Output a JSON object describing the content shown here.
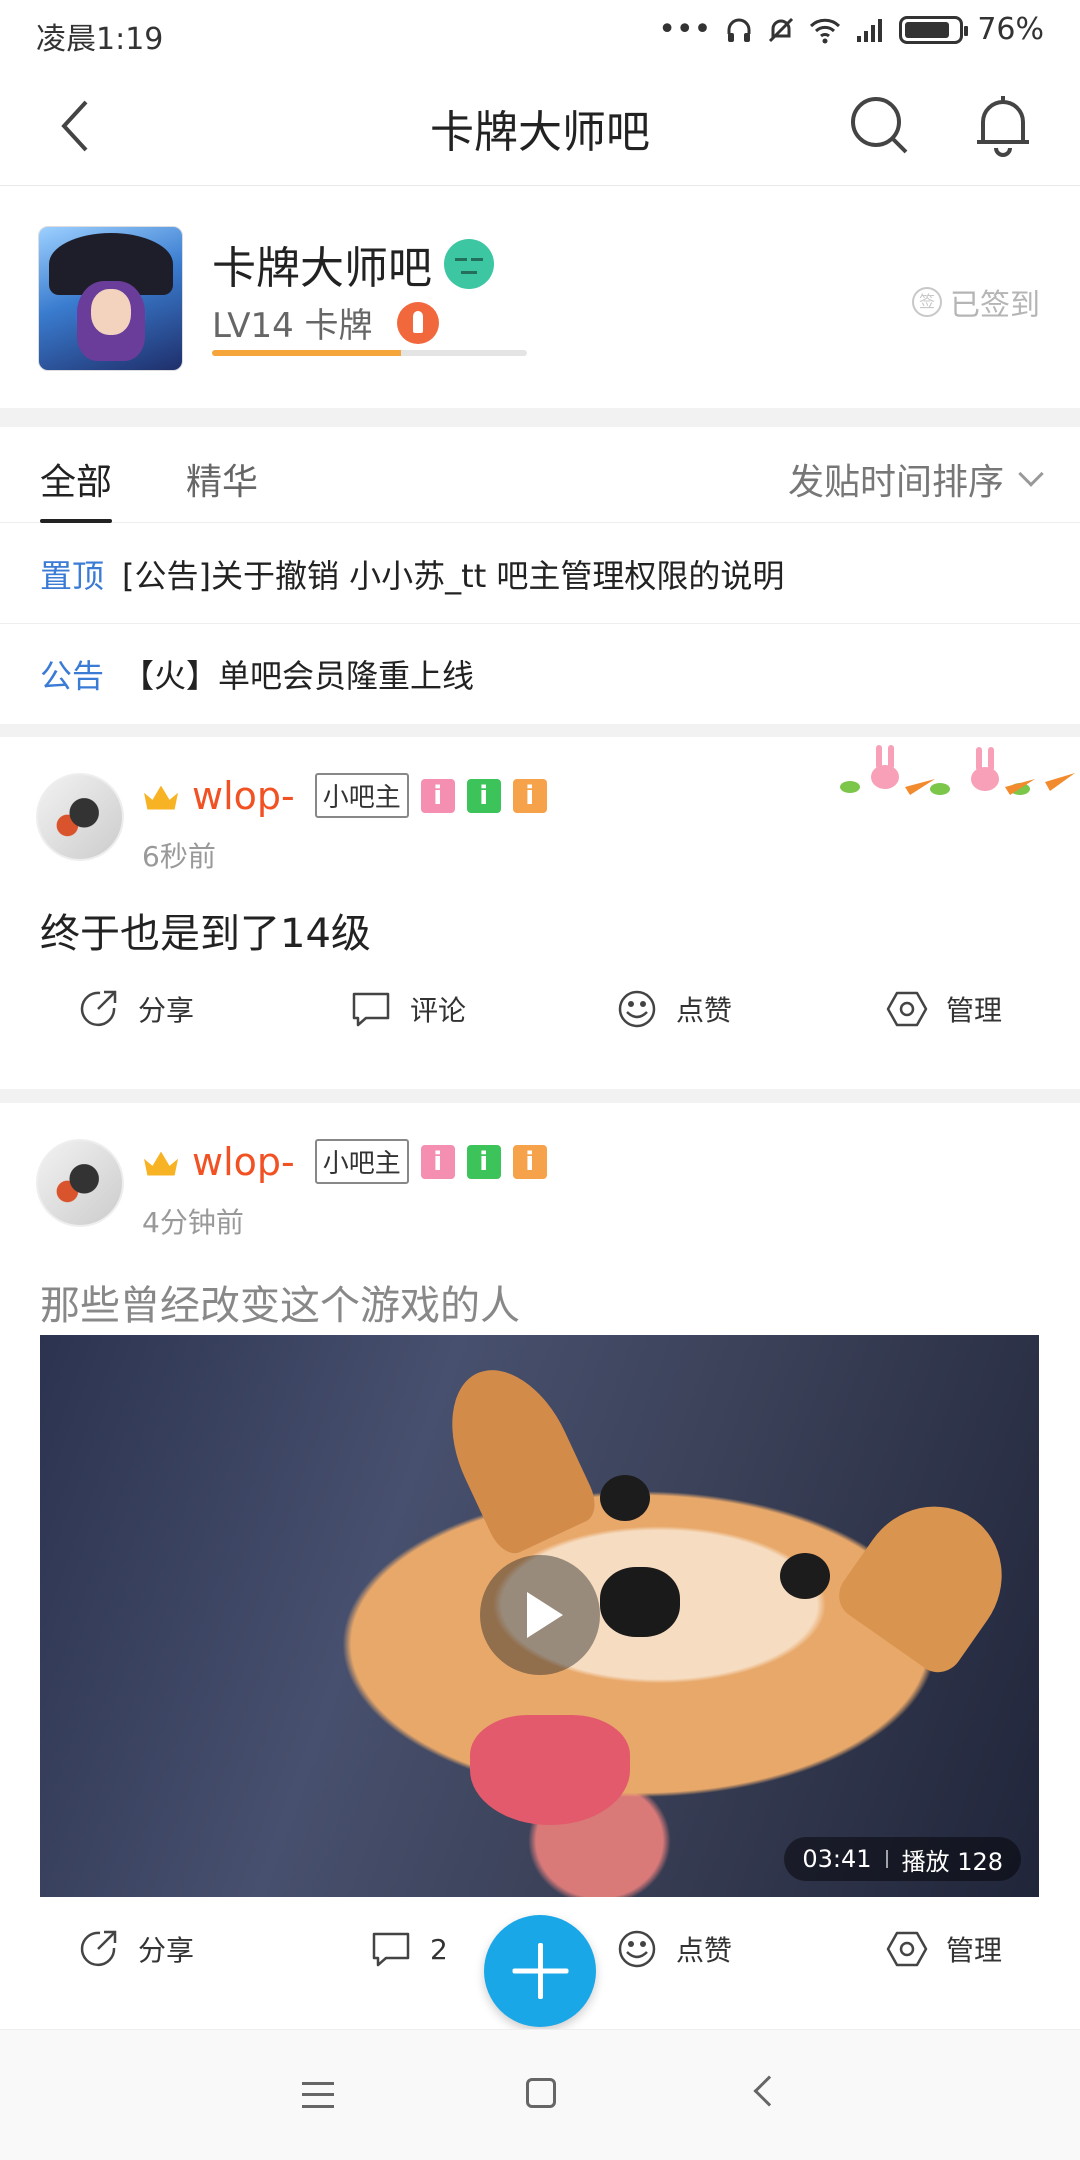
{
  "status": {
    "time": "凌晨1:19",
    "battery": "76%",
    "battery_level": 0.76,
    "dots": "•••"
  },
  "nav": {
    "title": "卡牌大师吧"
  },
  "forum": {
    "name": "卡牌大师吧",
    "level": "LV14 卡牌",
    "level_progress": 0.6,
    "signed": "已签到"
  },
  "tabs": {
    "all": "全部",
    "good": "精华",
    "sort": "发贴时间排序"
  },
  "pins": [
    {
      "tag": "置顶",
      "text": "[公告]关于撤销 小小苏_tt 吧主管理权限的说明"
    },
    {
      "tag": "公告",
      "text": "【火】单吧会员隆重上线"
    }
  ],
  "posts": [
    {
      "user": "wlop-",
      "role": "小吧主",
      "badges": [
        "i",
        "i",
        "i"
      ],
      "time": "6秒前",
      "text": "终于也是到了14级",
      "actions": {
        "share": "分享",
        "comment": "评论",
        "like": "点赞",
        "manage": "管理"
      }
    },
    {
      "user": "wlop-",
      "role": "小吧主",
      "badges": [
        "i",
        "i",
        "i"
      ],
      "time": "4分钟前",
      "text": "那些曾经改变这个游戏的人",
      "video": {
        "duration": "03:41",
        "plays": "播放 128"
      },
      "actions": {
        "share": "分享",
        "comment": "2",
        "like": "点赞",
        "manage": "管理"
      }
    }
  ],
  "colors": {
    "accent": "#1aa7e8",
    "username": "#f25223",
    "tag": "#3a7bd5"
  }
}
